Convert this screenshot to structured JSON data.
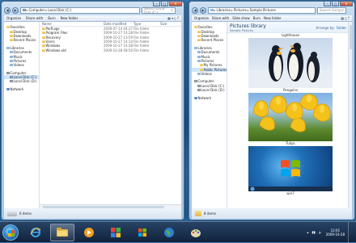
{
  "left_window": {
    "address": [
      "Computer",
      "Local Disk (C:)"
    ],
    "search_placeholder": "Search Local Disk (C:)",
    "toolbar": [
      "Organize",
      "Share with",
      "Burn",
      "New folder"
    ],
    "nav": {
      "favorites": "Favorites",
      "favorites_items": [
        "Desktop",
        "Downloads",
        "Recent Places"
      ],
      "libraries": "Libraries",
      "libraries_items": [
        "Documents",
        "Music",
        "Pictures",
        "Videos"
      ],
      "computer": "Computer",
      "computer_items": [
        "Local Disk (C:)",
        "Local Disk (D:)"
      ],
      "network": "Network"
    },
    "columns": {
      "name": "Name",
      "date": "Date modified",
      "type": "Type",
      "size": "Size"
    },
    "rows": [
      {
        "name": "PerfLogs",
        "date": "2009-07-14 04:37",
        "type": "File folder"
      },
      {
        "name": "Program Files",
        "date": "2009-10-27 14:28",
        "type": "File folder"
      },
      {
        "name": "Recovery",
        "date": "2009-10-27 13:59",
        "type": "File folder"
      },
      {
        "name": "Users",
        "date": "2009-10-27 14:14",
        "type": "File folder"
      },
      {
        "name": "Windows",
        "date": "2009-10-27 14:28",
        "type": "File folder"
      },
      {
        "name": "Windows.old",
        "date": "2009-10-28 08:50",
        "type": "File folder"
      }
    ],
    "status": "6 items"
  },
  "right_window": {
    "address": [
      "Libraries",
      "Pictures",
      "Sample Pictures"
    ],
    "search_placeholder": "Search Sample Pictures",
    "toolbar": [
      "Organize",
      "Share with",
      "Slide show",
      "Burn",
      "New folder"
    ],
    "nav": {
      "favorites": "Favorites",
      "favorites_items": [
        "Desktop",
        "Downloads",
        "Recent Places"
      ],
      "libraries": "Libraries",
      "libraries_items": [
        "Documents",
        "Music",
        "Pictures",
        "Videos"
      ],
      "pictures_sub": [
        "My Pictures",
        "Public Pictures"
      ],
      "computer": "Computer",
      "computer_items": [
        "Local Disk (C:)",
        "Local Disk (D:)"
      ],
      "network": "Network"
    },
    "library_title": "Pictures library",
    "library_subtitle": "Sample Pictures",
    "arrange_label": "Arrange by:",
    "arrange_value": "Folder",
    "captions": [
      "Lighthouse",
      "Penguins",
      "Tulips",
      "win7"
    ],
    "status": "8 items"
  },
  "taskbar": {
    "clock_time": "12:01",
    "clock_date": "2009-10-28"
  }
}
